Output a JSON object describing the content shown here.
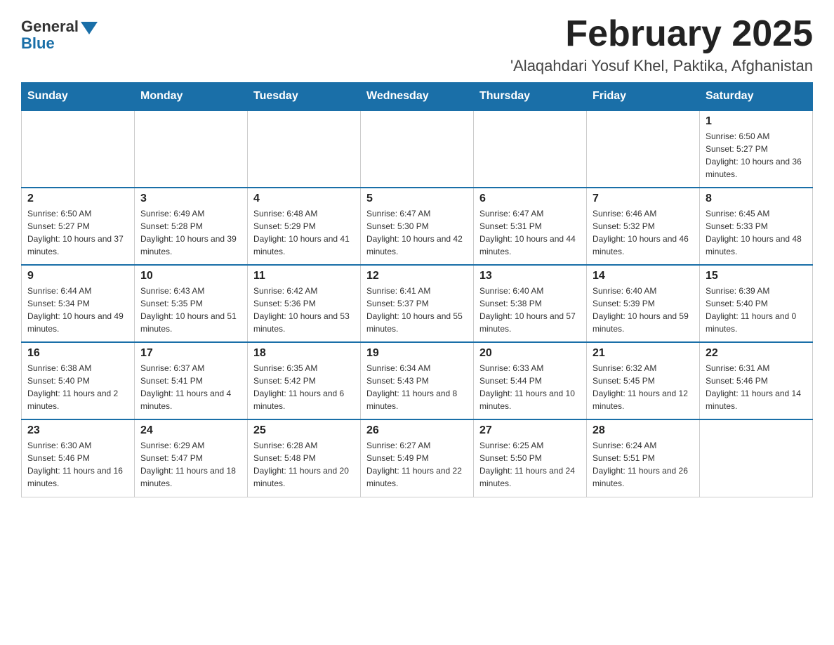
{
  "header": {
    "logo_general": "General",
    "logo_blue": "Blue",
    "month_title": "February 2025",
    "location": "'Alaqahdari Yosuf Khel, Paktika, Afghanistan"
  },
  "weekdays": [
    "Sunday",
    "Monday",
    "Tuesday",
    "Wednesday",
    "Thursday",
    "Friday",
    "Saturday"
  ],
  "weeks": [
    [
      {
        "day": "",
        "info": ""
      },
      {
        "day": "",
        "info": ""
      },
      {
        "day": "",
        "info": ""
      },
      {
        "day": "",
        "info": ""
      },
      {
        "day": "",
        "info": ""
      },
      {
        "day": "",
        "info": ""
      },
      {
        "day": "1",
        "info": "Sunrise: 6:50 AM\nSunset: 5:27 PM\nDaylight: 10 hours and 36 minutes."
      }
    ],
    [
      {
        "day": "2",
        "info": "Sunrise: 6:50 AM\nSunset: 5:27 PM\nDaylight: 10 hours and 37 minutes."
      },
      {
        "day": "3",
        "info": "Sunrise: 6:49 AM\nSunset: 5:28 PM\nDaylight: 10 hours and 39 minutes."
      },
      {
        "day": "4",
        "info": "Sunrise: 6:48 AM\nSunset: 5:29 PM\nDaylight: 10 hours and 41 minutes."
      },
      {
        "day": "5",
        "info": "Sunrise: 6:47 AM\nSunset: 5:30 PM\nDaylight: 10 hours and 42 minutes."
      },
      {
        "day": "6",
        "info": "Sunrise: 6:47 AM\nSunset: 5:31 PM\nDaylight: 10 hours and 44 minutes."
      },
      {
        "day": "7",
        "info": "Sunrise: 6:46 AM\nSunset: 5:32 PM\nDaylight: 10 hours and 46 minutes."
      },
      {
        "day": "8",
        "info": "Sunrise: 6:45 AM\nSunset: 5:33 PM\nDaylight: 10 hours and 48 minutes."
      }
    ],
    [
      {
        "day": "9",
        "info": "Sunrise: 6:44 AM\nSunset: 5:34 PM\nDaylight: 10 hours and 49 minutes."
      },
      {
        "day": "10",
        "info": "Sunrise: 6:43 AM\nSunset: 5:35 PM\nDaylight: 10 hours and 51 minutes."
      },
      {
        "day": "11",
        "info": "Sunrise: 6:42 AM\nSunset: 5:36 PM\nDaylight: 10 hours and 53 minutes."
      },
      {
        "day": "12",
        "info": "Sunrise: 6:41 AM\nSunset: 5:37 PM\nDaylight: 10 hours and 55 minutes."
      },
      {
        "day": "13",
        "info": "Sunrise: 6:40 AM\nSunset: 5:38 PM\nDaylight: 10 hours and 57 minutes."
      },
      {
        "day": "14",
        "info": "Sunrise: 6:40 AM\nSunset: 5:39 PM\nDaylight: 10 hours and 59 minutes."
      },
      {
        "day": "15",
        "info": "Sunrise: 6:39 AM\nSunset: 5:40 PM\nDaylight: 11 hours and 0 minutes."
      }
    ],
    [
      {
        "day": "16",
        "info": "Sunrise: 6:38 AM\nSunset: 5:40 PM\nDaylight: 11 hours and 2 minutes."
      },
      {
        "day": "17",
        "info": "Sunrise: 6:37 AM\nSunset: 5:41 PM\nDaylight: 11 hours and 4 minutes."
      },
      {
        "day": "18",
        "info": "Sunrise: 6:35 AM\nSunset: 5:42 PM\nDaylight: 11 hours and 6 minutes."
      },
      {
        "day": "19",
        "info": "Sunrise: 6:34 AM\nSunset: 5:43 PM\nDaylight: 11 hours and 8 minutes."
      },
      {
        "day": "20",
        "info": "Sunrise: 6:33 AM\nSunset: 5:44 PM\nDaylight: 11 hours and 10 minutes."
      },
      {
        "day": "21",
        "info": "Sunrise: 6:32 AM\nSunset: 5:45 PM\nDaylight: 11 hours and 12 minutes."
      },
      {
        "day": "22",
        "info": "Sunrise: 6:31 AM\nSunset: 5:46 PM\nDaylight: 11 hours and 14 minutes."
      }
    ],
    [
      {
        "day": "23",
        "info": "Sunrise: 6:30 AM\nSunset: 5:46 PM\nDaylight: 11 hours and 16 minutes."
      },
      {
        "day": "24",
        "info": "Sunrise: 6:29 AM\nSunset: 5:47 PM\nDaylight: 11 hours and 18 minutes."
      },
      {
        "day": "25",
        "info": "Sunrise: 6:28 AM\nSunset: 5:48 PM\nDaylight: 11 hours and 20 minutes."
      },
      {
        "day": "26",
        "info": "Sunrise: 6:27 AM\nSunset: 5:49 PM\nDaylight: 11 hours and 22 minutes."
      },
      {
        "day": "27",
        "info": "Sunrise: 6:25 AM\nSunset: 5:50 PM\nDaylight: 11 hours and 24 minutes."
      },
      {
        "day": "28",
        "info": "Sunrise: 6:24 AM\nSunset: 5:51 PM\nDaylight: 11 hours and 26 minutes."
      },
      {
        "day": "",
        "info": ""
      }
    ]
  ]
}
